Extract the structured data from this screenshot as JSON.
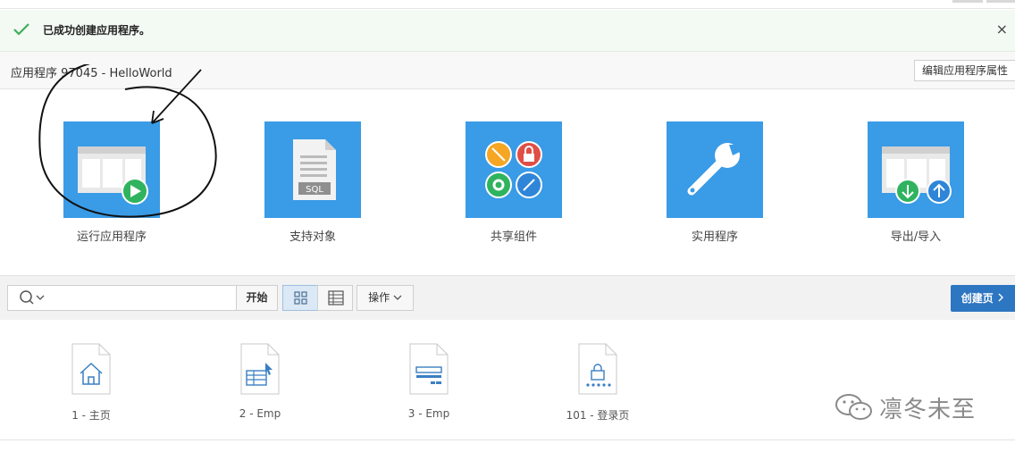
{
  "notification": {
    "message": "已成功创建应用程序。",
    "close": "×"
  },
  "app_header": {
    "title": "应用程序 97045 - HelloWorld",
    "edit_button": "编辑应用程序属性"
  },
  "tiles": [
    {
      "label": "运行应用程序",
      "icon": "run-app-icon"
    },
    {
      "label": "支持对象",
      "icon": "sql-document-icon"
    },
    {
      "label": "共享组件",
      "icon": "shared-components-icon"
    },
    {
      "label": "实用程序",
      "icon": "wrench-icon"
    },
    {
      "label": "导出/导入",
      "icon": "export-import-icon"
    }
  ],
  "toolbar": {
    "search_value": "",
    "go_label": "开始",
    "actions_label": "操作",
    "create_page_label": "创建页"
  },
  "pages": [
    {
      "label": "1 - 主页",
      "icon": "home-page-icon"
    },
    {
      "label": "2 - Emp",
      "icon": "form-page-icon"
    },
    {
      "label": "3 - Emp",
      "icon": "report-page-icon"
    },
    {
      "label": "101 - 登录页",
      "icon": "login-page-icon"
    }
  ],
  "watermark": "凛冬未至",
  "colors": {
    "tile_blue": "#3a9be6",
    "create_btn": "#2d76c1",
    "success_bg": "#f3f9f3",
    "check_green": "#3dae5c"
  }
}
